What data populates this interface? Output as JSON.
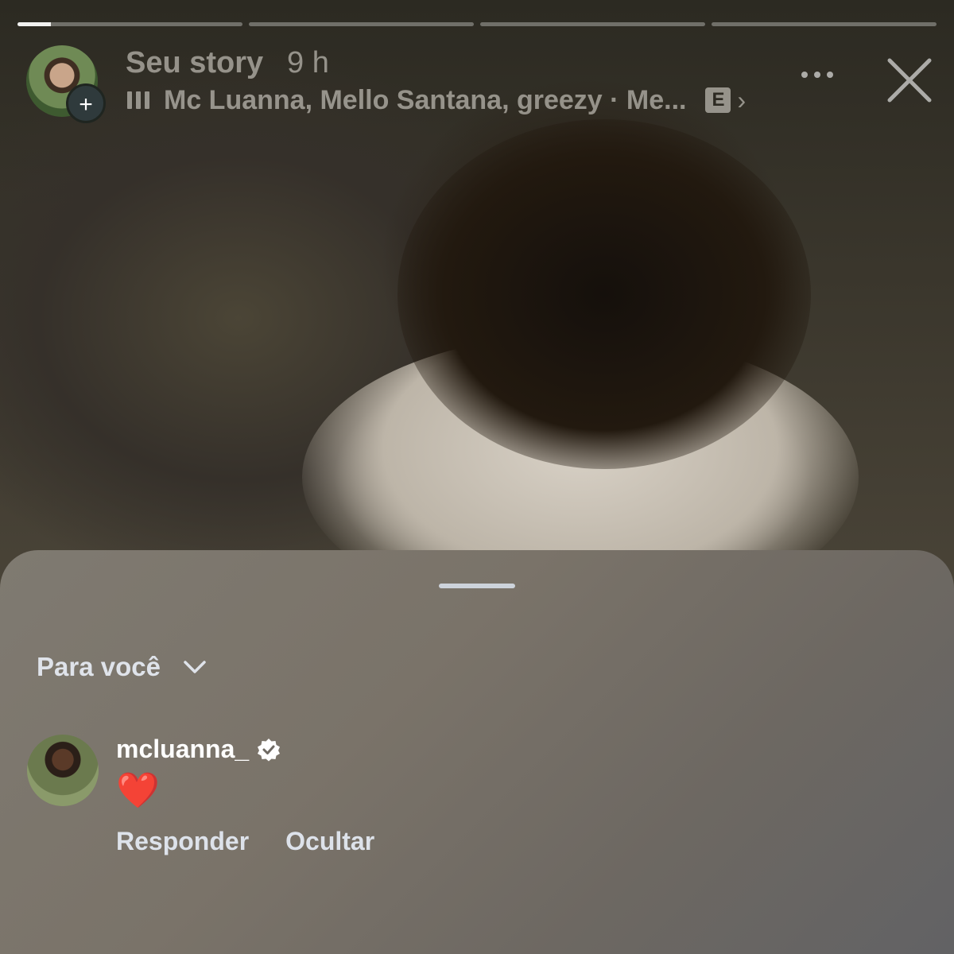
{
  "story": {
    "progress_segments": [
      0.15,
      0,
      0,
      0
    ],
    "header": {
      "title": "Seu story",
      "time": "9 h",
      "add_symbol": "+",
      "music_icon": "sound-bars-icon",
      "music_text": "Mc Luanna, Mello Santana, greezy · Me...",
      "explicit_badge": "E",
      "chevron": "›",
      "more_icon": "ellipsis-icon",
      "close_icon": "close-icon"
    }
  },
  "sheet": {
    "filter_label": "Para você",
    "comment": {
      "username": "mcluanna_",
      "verified": true,
      "text": "❤️",
      "reply_label": "Responder",
      "hide_label": "Ocultar"
    }
  },
  "colors": {
    "sheet_text": "#dfe3ea",
    "heart": "#e0202a"
  }
}
